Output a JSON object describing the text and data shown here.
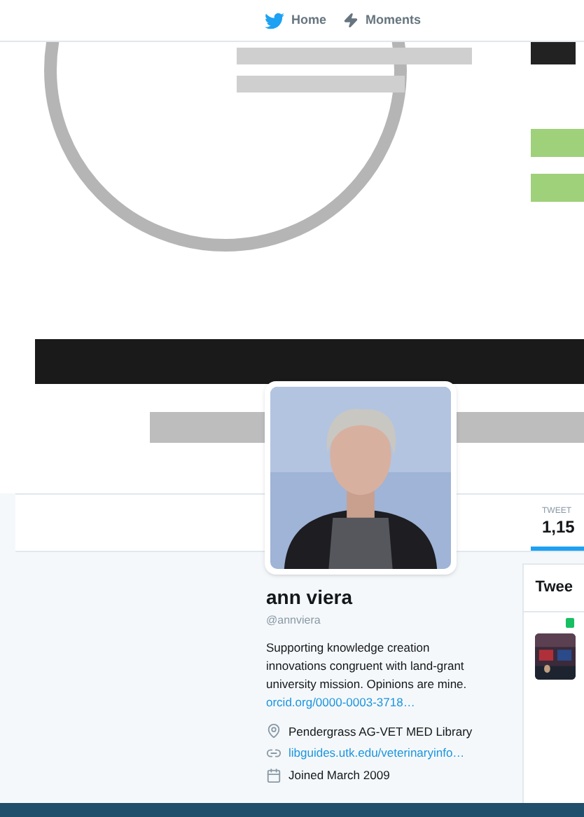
{
  "nav": [
    {
      "label": "Home",
      "kind": "bird"
    },
    {
      "label": "Moments",
      "kind": "bolt"
    }
  ],
  "stats": [
    {
      "label": "TWEET",
      "value": "1,15",
      "selected": true
    }
  ],
  "profile": {
    "name": "ann viera",
    "handle": "@annviera",
    "bio": "Supporting knowledge creation innovations congruent with land-grant university mission. Opinions are mine.",
    "bio_link": "orcid.org/0000-0003-3718…",
    "details": [
      {
        "kind": "location",
        "text": "Pendergrass AG-VET MED Library"
      },
      {
        "kind": "link",
        "text": "libguides.utk.edu/veterinaryinfo…"
      },
      {
        "kind": "joined",
        "text": "Joined March 2009"
      }
    ]
  },
  "timeline": {
    "title": "Twee"
  }
}
